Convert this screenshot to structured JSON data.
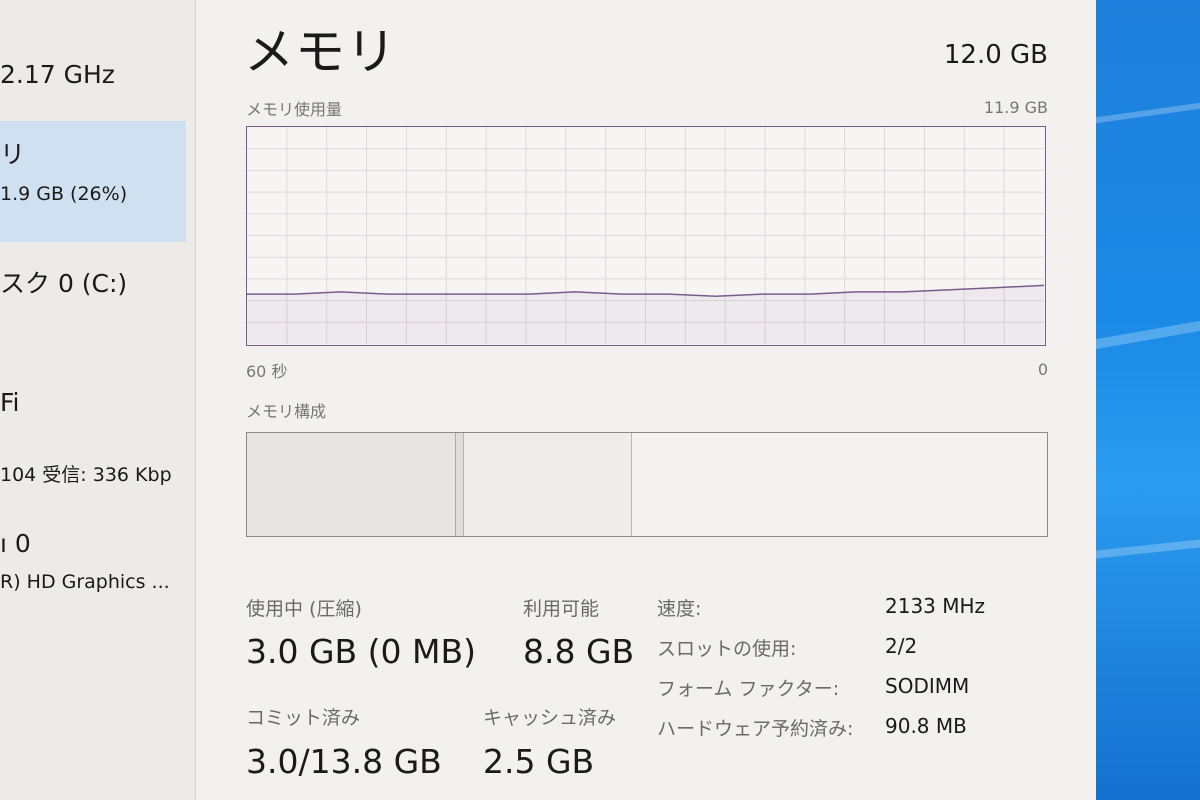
{
  "sidebar": {
    "items": [
      {
        "line1": "",
        "line2": "2.17 GHz"
      },
      {
        "line1": "リ",
        "line2": "1.9 GB (26%)",
        "selected": true
      },
      {
        "line1": "スク 0 (C:)",
        "line2": ""
      },
      {
        "line1": "Fi",
        "line2": "104 受信: 336 Kbp"
      },
      {
        "line1": "ı 0",
        "line2": "R) HD Graphics ..."
      }
    ]
  },
  "header": {
    "title": "メモリ",
    "total": "12.0 GB"
  },
  "usage_graph": {
    "label": "メモリ使用量",
    "max_label": "11.9 GB",
    "time_left": "60 秒",
    "time_right": "0",
    "line_color": "#7a5c8c",
    "usage_series_fraction_of_max": [
      0.23,
      0.23,
      0.24,
      0.23,
      0.23,
      0.23,
      0.23,
      0.24,
      0.23,
      0.23,
      0.22,
      0.23,
      0.23,
      0.24,
      0.24,
      0.25,
      0.26,
      0.27
    ]
  },
  "composition": {
    "label": "メモリ構成",
    "segments": [
      {
        "name": "in_use",
        "fraction": 0.26
      },
      {
        "name": "modified",
        "fraction": 0.01
      },
      {
        "name": "standby",
        "fraction": 0.21
      },
      {
        "name": "free",
        "fraction": 0.52
      }
    ]
  },
  "stats": {
    "in_use_label": "使用中 (圧縮)",
    "in_use_value": "3.0 GB (0 MB)",
    "available_label": "利用可能",
    "available_value": "8.8 GB",
    "committed_label": "コミット済み",
    "committed_value": "3.0/13.8 GB",
    "cached_label": "キャッシュ済み",
    "cached_value": "2.5 GB"
  },
  "properties": [
    {
      "label": "速度:",
      "value": "2133 MHz"
    },
    {
      "label": "スロットの使用:",
      "value": "2/2"
    },
    {
      "label": "フォーム ファクター:",
      "value": "SODIMM"
    },
    {
      "label": "ハードウェア予約済み:",
      "value": "90.8 MB"
    }
  ]
}
